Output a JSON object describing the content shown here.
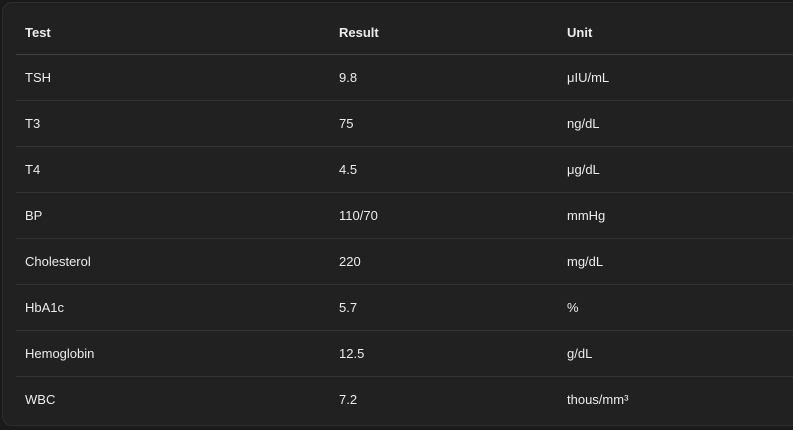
{
  "table": {
    "headers": [
      "Test",
      "Result",
      "Unit"
    ],
    "rows": [
      {
        "test": "TSH",
        "result": "9.8",
        "unit": "μIU/mL"
      },
      {
        "test": "T3",
        "result": "75",
        "unit": "ng/dL"
      },
      {
        "test": "T4",
        "result": "4.5",
        "unit": "μg/dL"
      },
      {
        "test": "BP",
        "result": "110/70",
        "unit": "mmHg"
      },
      {
        "test": "Cholesterol",
        "result": "220",
        "unit": "mg/dL"
      },
      {
        "test": "HbA1c",
        "result": "5.7",
        "unit": "%"
      },
      {
        "test": "Hemoglobin",
        "result": "12.5",
        "unit": "g/dL"
      },
      {
        "test": "WBC",
        "result": "7.2",
        "unit": "thous/mm³"
      }
    ]
  }
}
